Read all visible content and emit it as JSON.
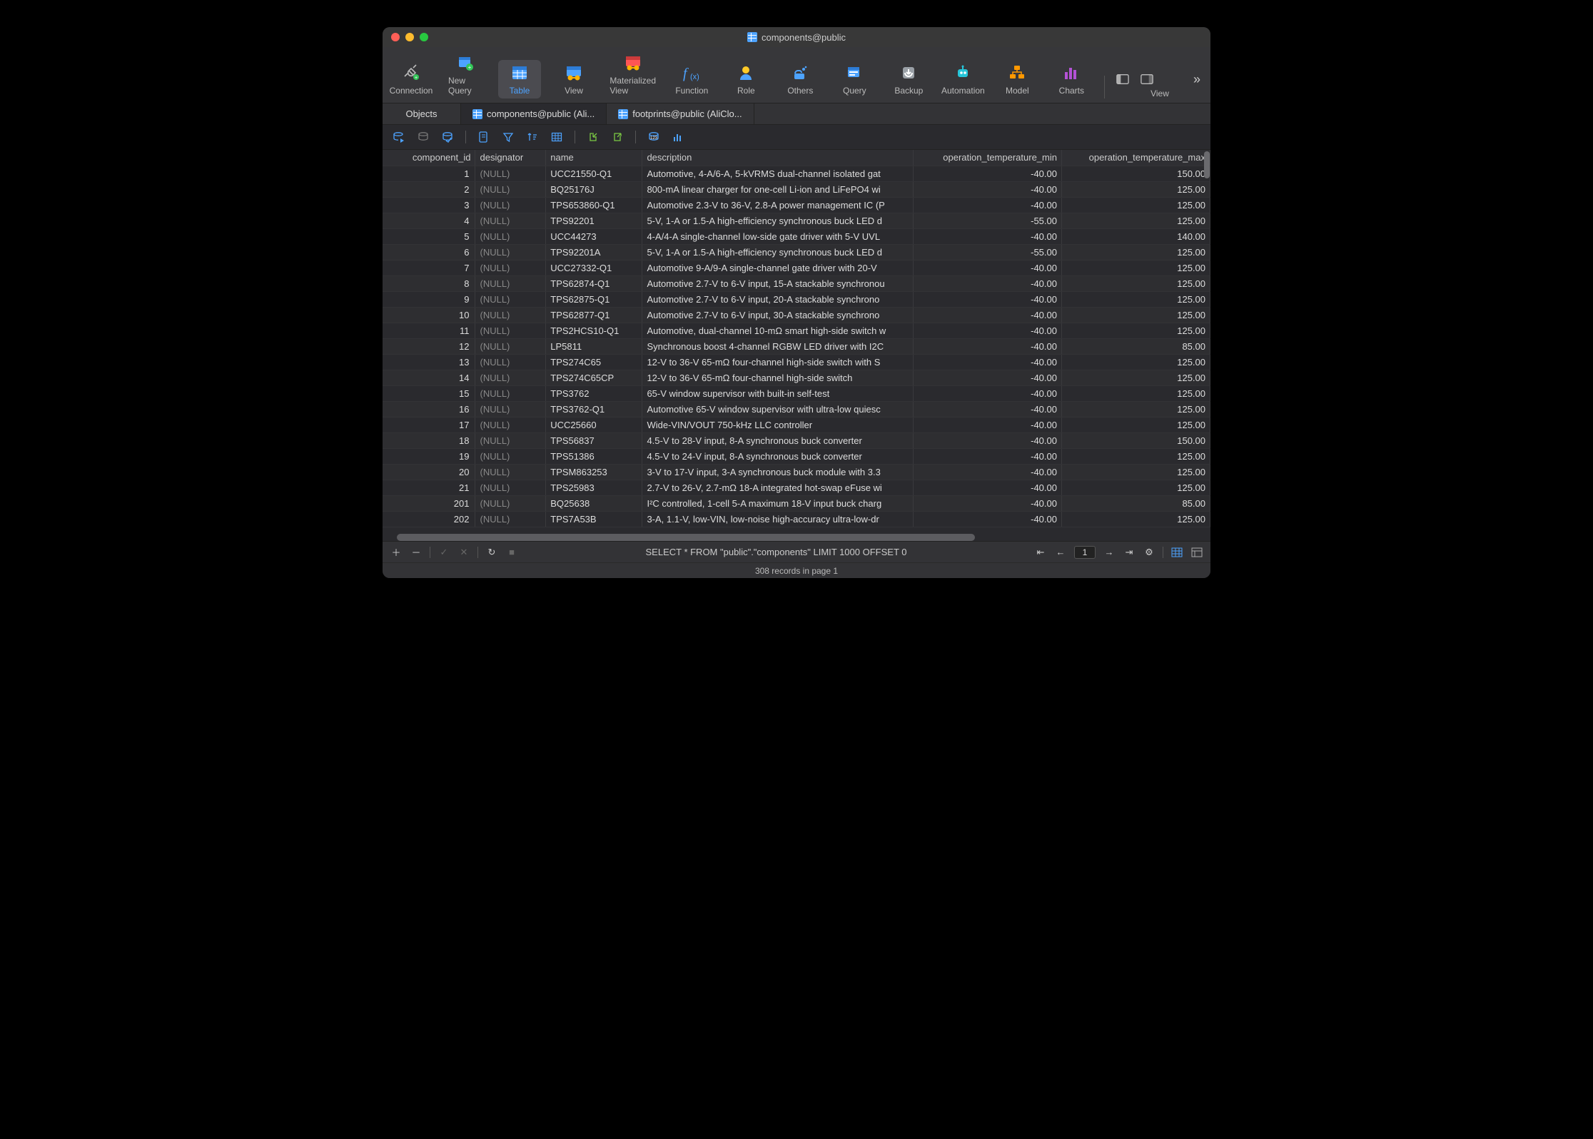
{
  "title": "components@public",
  "toolbar": [
    {
      "label": "Connection",
      "name": "connection-button",
      "icon": "plug"
    },
    {
      "label": "New Query",
      "name": "new-query-button",
      "icon": "db-plus"
    },
    {
      "label": "Table",
      "name": "table-button",
      "icon": "table",
      "active": true
    },
    {
      "label": "View",
      "name": "view-button",
      "icon": "view"
    },
    {
      "label": "Materialized View",
      "name": "materialized-view-button",
      "icon": "mview"
    },
    {
      "label": "Function",
      "name": "function-button",
      "icon": "fx"
    },
    {
      "label": "Role",
      "name": "role-button",
      "icon": "role"
    },
    {
      "label": "Others",
      "name": "others-button",
      "icon": "others"
    },
    {
      "label": "Query",
      "name": "query-button",
      "icon": "query"
    },
    {
      "label": "Backup",
      "name": "backup-button",
      "icon": "backup"
    },
    {
      "label": "Automation",
      "name": "automation-button",
      "icon": "automation"
    },
    {
      "label": "Model",
      "name": "model-button",
      "icon": "model"
    },
    {
      "label": "Charts",
      "name": "charts-button",
      "icon": "charts"
    }
  ],
  "toolbar_right": {
    "view_label": "View"
  },
  "tabs": {
    "objects": "Objects",
    "items": [
      {
        "label": "components@public (Ali...",
        "active": true
      },
      {
        "label": "footprints@public (AliClo..."
      }
    ]
  },
  "columns": [
    {
      "key": "component_id",
      "label": "component_id",
      "cls": "col-id"
    },
    {
      "key": "designator",
      "label": "designator",
      "cls": "col-desig"
    },
    {
      "key": "name",
      "label": "name",
      "cls": "col-name"
    },
    {
      "key": "description",
      "label": "description",
      "cls": "col-desc"
    },
    {
      "key": "tmin",
      "label": "operation_temperature_min",
      "cls": "col-tmin"
    },
    {
      "key": "tmax",
      "label": "operation_temperature_max",
      "cls": "col-tmax"
    }
  ],
  "rows": [
    {
      "component_id": "1",
      "designator": "(NULL)",
      "name": "UCC21550-Q1",
      "description": "Automotive, 4-A/6-A, 5-kVRMS dual-channel isolated gat",
      "tmin": "-40.00",
      "tmax": "150.00"
    },
    {
      "component_id": "2",
      "designator": "(NULL)",
      "name": "BQ25176J",
      "description": "800-mA linear charger for one-cell Li-ion and LiFePO4 wi",
      "tmin": "-40.00",
      "tmax": "125.00"
    },
    {
      "component_id": "3",
      "designator": "(NULL)",
      "name": "TPS653860-Q1",
      "description": "Automotive 2.3-V to 36-V, 2.8-A power management IC (P",
      "tmin": "-40.00",
      "tmax": "125.00"
    },
    {
      "component_id": "4",
      "designator": "(NULL)",
      "name": "TPS92201",
      "description": "5-V, 1-A or 1.5-A high-efficiency synchronous buck LED d",
      "tmin": "-55.00",
      "tmax": "125.00"
    },
    {
      "component_id": "5",
      "designator": "(NULL)",
      "name": "UCC44273",
      "description": "4-A/4-A single-channel low-side gate driver with 5-V UVL",
      "tmin": "-40.00",
      "tmax": "140.00"
    },
    {
      "component_id": "6",
      "designator": "(NULL)",
      "name": "TPS92201A",
      "description": "5-V, 1-A or 1.5-A high-efficiency synchronous buck LED d",
      "tmin": "-55.00",
      "tmax": "125.00"
    },
    {
      "component_id": "7",
      "designator": "(NULL)",
      "name": "UCC27332-Q1",
      "description": "Automotive 9-A/9-A single-channel gate driver with 20-V",
      "tmin": "-40.00",
      "tmax": "125.00"
    },
    {
      "component_id": "8",
      "designator": "(NULL)",
      "name": "TPS62874-Q1",
      "description": "Automotive 2.7-V to 6-V input, 15-A stackable synchronou",
      "tmin": "-40.00",
      "tmax": "125.00"
    },
    {
      "component_id": "9",
      "designator": "(NULL)",
      "name": "TPS62875-Q1",
      "description": "Automotive 2.7-V to 6-V input, 20-A stackable synchrono",
      "tmin": "-40.00",
      "tmax": "125.00"
    },
    {
      "component_id": "10",
      "designator": "(NULL)",
      "name": "TPS62877-Q1",
      "description": "Automotive 2.7-V to 6-V input, 30-A stackable synchrono",
      "tmin": "-40.00",
      "tmax": "125.00"
    },
    {
      "component_id": "11",
      "designator": "(NULL)",
      "name": "TPS2HCS10-Q1",
      "description": "Automotive, dual-channel 10-mΩ smart high-side switch w",
      "tmin": "-40.00",
      "tmax": "125.00"
    },
    {
      "component_id": "12",
      "designator": "(NULL)",
      "name": "LP5811",
      "description": "Synchronous boost 4-channel RGBW LED driver with I2C",
      "tmin": "-40.00",
      "tmax": "85.00"
    },
    {
      "component_id": "13",
      "designator": "(NULL)",
      "name": "TPS274C65",
      "description": "12-V to 36-V 65-mΩ four-channel high-side switch with S",
      "tmin": "-40.00",
      "tmax": "125.00"
    },
    {
      "component_id": "14",
      "designator": "(NULL)",
      "name": "TPS274C65CP",
      "description": "12-V to 36-V 65-mΩ four-channel high-side switch",
      "tmin": "-40.00",
      "tmax": "125.00"
    },
    {
      "component_id": "15",
      "designator": "(NULL)",
      "name": "TPS3762",
      "description": "65-V window supervisor with built-in self-test",
      "tmin": "-40.00",
      "tmax": "125.00"
    },
    {
      "component_id": "16",
      "designator": "(NULL)",
      "name": "TPS3762-Q1",
      "description": "Automotive 65-V window supervisor with ultra-low quiesc",
      "tmin": "-40.00",
      "tmax": "125.00"
    },
    {
      "component_id": "17",
      "designator": "(NULL)",
      "name": "UCC25660",
      "description": "Wide-VIN/VOUT 750-kHz LLC controller",
      "tmin": "-40.00",
      "tmax": "125.00"
    },
    {
      "component_id": "18",
      "designator": "(NULL)",
      "name": "TPS56837",
      "description": "4.5-V to 28-V input, 8-A synchronous buck converter",
      "tmin": "-40.00",
      "tmax": "150.00"
    },
    {
      "component_id": "19",
      "designator": "(NULL)",
      "name": "TPS51386",
      "description": "4.5-V to 24-V input, 8-A synchronous buck converter",
      "tmin": "-40.00",
      "tmax": "125.00"
    },
    {
      "component_id": "20",
      "designator": "(NULL)",
      "name": "TPSM863253",
      "description": "3-V to 17-V input, 3-A synchronous buck module with 3.3",
      "tmin": "-40.00",
      "tmax": "125.00"
    },
    {
      "component_id": "21",
      "designator": "(NULL)",
      "name": "TPS25983",
      "description": "2.7-V to 26-V, 2.7-mΩ 18-A integrated hot-swap eFuse wi",
      "tmin": "-40.00",
      "tmax": "125.00"
    },
    {
      "component_id": "201",
      "designator": "(NULL)",
      "name": "BQ25638",
      "description": "I²C controlled, 1-cell 5-A maximum 18-V input buck charg",
      "tmin": "-40.00",
      "tmax": "85.00"
    },
    {
      "component_id": "202",
      "designator": "(NULL)",
      "name": "TPS7A53B",
      "description": "3-A, 1.1-V, low-VIN, low-noise high-accuracy ultra-low-dr",
      "tmin": "-40.00",
      "tmax": "125.00"
    }
  ],
  "footer": {
    "sql": "SELECT * FROM \"public\".\"components\" LIMIT 1000 OFFSET 0",
    "page": "1"
  },
  "status": "308 records in page 1"
}
